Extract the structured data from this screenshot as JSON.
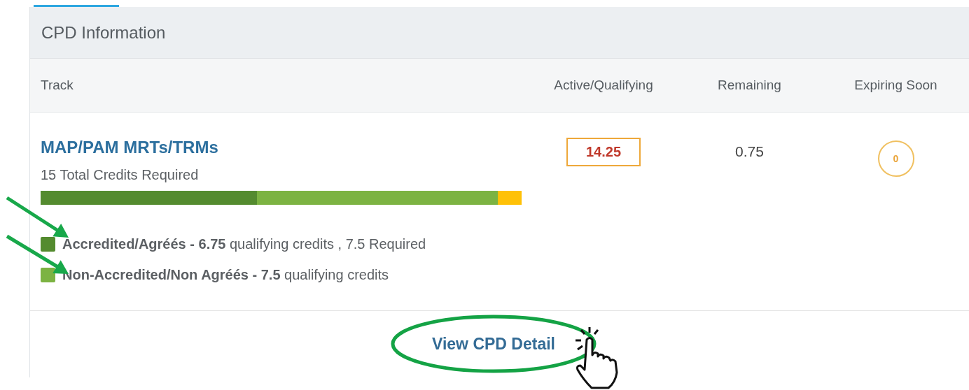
{
  "panel": {
    "title": "CPD Information"
  },
  "table": {
    "columns": [
      "Track",
      "Active/Qualifying",
      "Remaining",
      "Expiring Soon"
    ],
    "rows": [
      {
        "track": "MAP/PAM MRTs/TRMs",
        "subtitle": "15 Total Credits Required",
        "active": "14.25",
        "remaining": "0.75",
        "expiring": "0",
        "progress": [
          {
            "level": 0.45,
            "color": "#548b2f"
          },
          {
            "level": 0.95,
            "color": "#7cb342"
          },
          {
            "level": 1.0,
            "color": "#ffc107"
          }
        ],
        "legend": [
          {
            "text": "**Accredited/Agréés - 6.75** qualifying credits , 7.5 Required",
            "color": "#548b2f"
          },
          {
            "text": "**Non-Accredited/Non Agréés - 7.5** qualifying credits",
            "color": "#7cb342"
          }
        ]
      }
    ]
  },
  "footer": {
    "link": "View CPD Detail"
  },
  "annotations": [
    {
      "kind": "arrow"
    },
    {
      "kind": "arrow"
    },
    {
      "kind": "ellipse"
    },
    {
      "kind": "cursor"
    }
  ]
}
